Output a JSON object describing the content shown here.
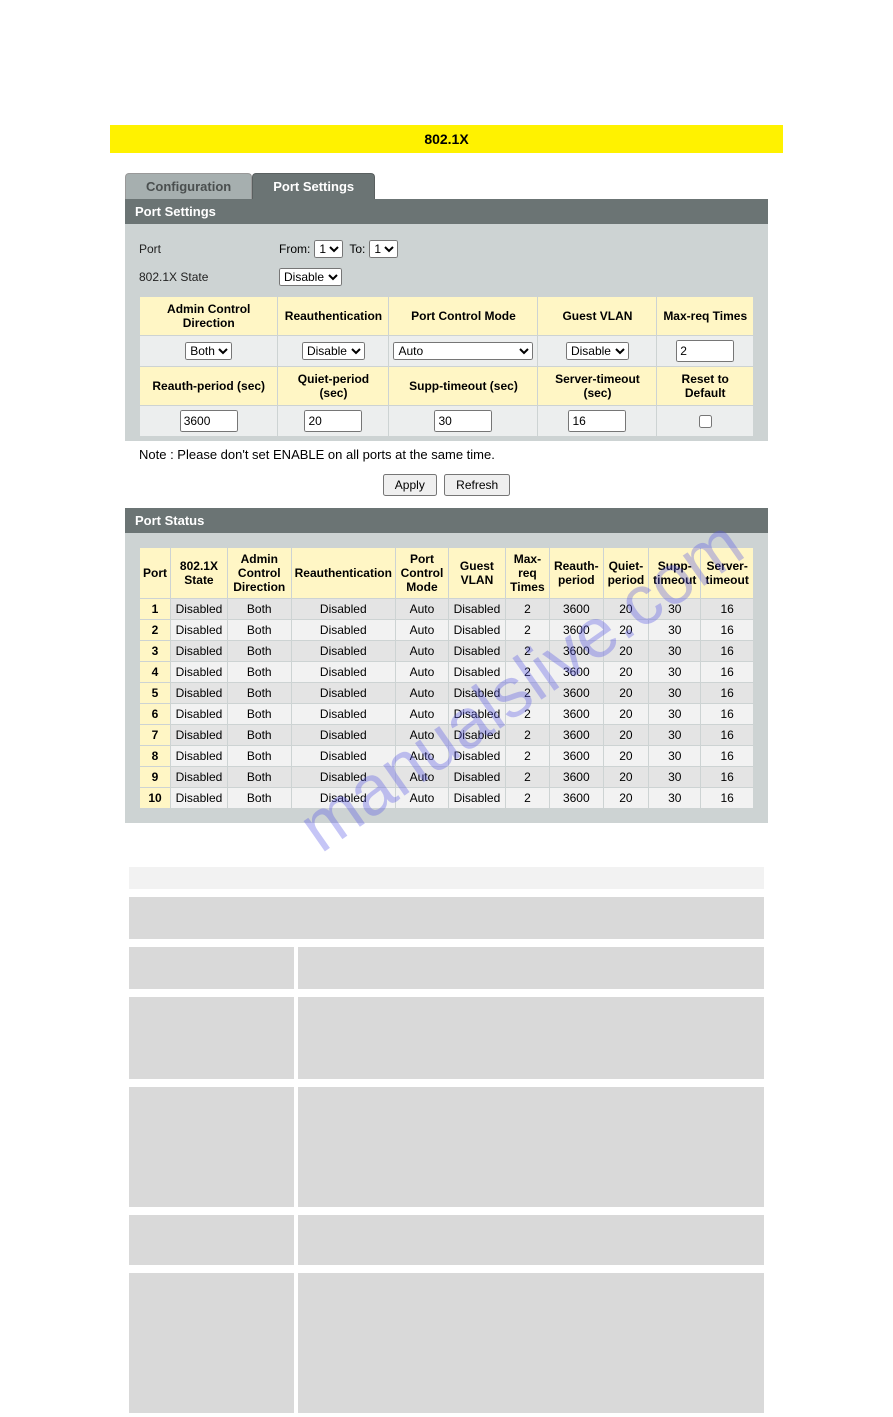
{
  "page_title": "802.1X",
  "tabs": {
    "inactive": "Configuration",
    "active": "Port Settings"
  },
  "section_port_settings": "Port Settings",
  "section_port_status": "Port Status",
  "labels": {
    "port": "Port",
    "from": "From:",
    "to": "To:",
    "state": "802.1X State"
  },
  "selects": {
    "from_value": "1",
    "to_value": "1",
    "state_value": "Disable"
  },
  "settings_headers_row1": {
    "admin_control": "Admin Control Direction",
    "reauth": "Reauthentication",
    "port_control": "Port Control Mode",
    "guest_vlan": "Guest VLAN",
    "max_req": "Max-req Times"
  },
  "settings_values_row1": {
    "admin_control": "Both",
    "reauth": "Disable",
    "port_control": "Auto",
    "guest_vlan": "Disable",
    "max_req": "2"
  },
  "settings_headers_row2": {
    "reauth_period": "Reauth-period (sec)",
    "quiet_period": "Quiet-period (sec)",
    "supp_timeout": "Supp-timeout (sec)",
    "server_timeout": "Server-timeout (sec)",
    "reset": "Reset to Default"
  },
  "settings_values_row2": {
    "reauth_period": "3600",
    "quiet_period": "20",
    "supp_timeout": "30",
    "server_timeout": "16"
  },
  "note": "Note : Please don't set ENABLE on all ports at the same time.",
  "buttons": {
    "apply": "Apply",
    "refresh": "Refresh"
  },
  "status_headers": {
    "port": "Port",
    "state": "802.1X State",
    "admin": "Admin Control Direction",
    "reauth": "Reauthentication",
    "mode": "Port Control Mode",
    "guest": "Guest VLAN",
    "max": "Max-req Times",
    "reauth_p": "Reauth-period",
    "quiet_p": "Quiet-period",
    "supp_t": "Supp-timeout",
    "server_t": "Server-timeout"
  },
  "status_rows": [
    {
      "port": "1",
      "state": "Disabled",
      "admin": "Both",
      "reauth": "Disabled",
      "mode": "Auto",
      "guest": "Disabled",
      "max": "2",
      "rp": "3600",
      "qp": "20",
      "st": "30",
      "svt": "16"
    },
    {
      "port": "2",
      "state": "Disabled",
      "admin": "Both",
      "reauth": "Disabled",
      "mode": "Auto",
      "guest": "Disabled",
      "max": "2",
      "rp": "3600",
      "qp": "20",
      "st": "30",
      "svt": "16"
    },
    {
      "port": "3",
      "state": "Disabled",
      "admin": "Both",
      "reauth": "Disabled",
      "mode": "Auto",
      "guest": "Disabled",
      "max": "2",
      "rp": "3600",
      "qp": "20",
      "st": "30",
      "svt": "16"
    },
    {
      "port": "4",
      "state": "Disabled",
      "admin": "Both",
      "reauth": "Disabled",
      "mode": "Auto",
      "guest": "Disabled",
      "max": "2",
      "rp": "3600",
      "qp": "20",
      "st": "30",
      "svt": "16"
    },
    {
      "port": "5",
      "state": "Disabled",
      "admin": "Both",
      "reauth": "Disabled",
      "mode": "Auto",
      "guest": "Disabled",
      "max": "2",
      "rp": "3600",
      "qp": "20",
      "st": "30",
      "svt": "16"
    },
    {
      "port": "6",
      "state": "Disabled",
      "admin": "Both",
      "reauth": "Disabled",
      "mode": "Auto",
      "guest": "Disabled",
      "max": "2",
      "rp": "3600",
      "qp": "20",
      "st": "30",
      "svt": "16"
    },
    {
      "port": "7",
      "state": "Disabled",
      "admin": "Both",
      "reauth": "Disabled",
      "mode": "Auto",
      "guest": "Disabled",
      "max": "2",
      "rp": "3600",
      "qp": "20",
      "st": "30",
      "svt": "16"
    },
    {
      "port": "8",
      "state": "Disabled",
      "admin": "Both",
      "reauth": "Disabled",
      "mode": "Auto",
      "guest": "Disabled",
      "max": "2",
      "rp": "3600",
      "qp": "20",
      "st": "30",
      "svt": "16"
    },
    {
      "port": "9",
      "state": "Disabled",
      "admin": "Both",
      "reauth": "Disabled",
      "mode": "Auto",
      "guest": "Disabled",
      "max": "2",
      "rp": "3600",
      "qp": "20",
      "st": "30",
      "svt": "16"
    },
    {
      "port": "10",
      "state": "Disabled",
      "admin": "Both",
      "reauth": "Disabled",
      "mode": "Auto",
      "guest": "Disabled",
      "max": "2",
      "rp": "3600",
      "qp": "20",
      "st": "30",
      "svt": "16"
    }
  ],
  "watermark": "manualslive.com"
}
